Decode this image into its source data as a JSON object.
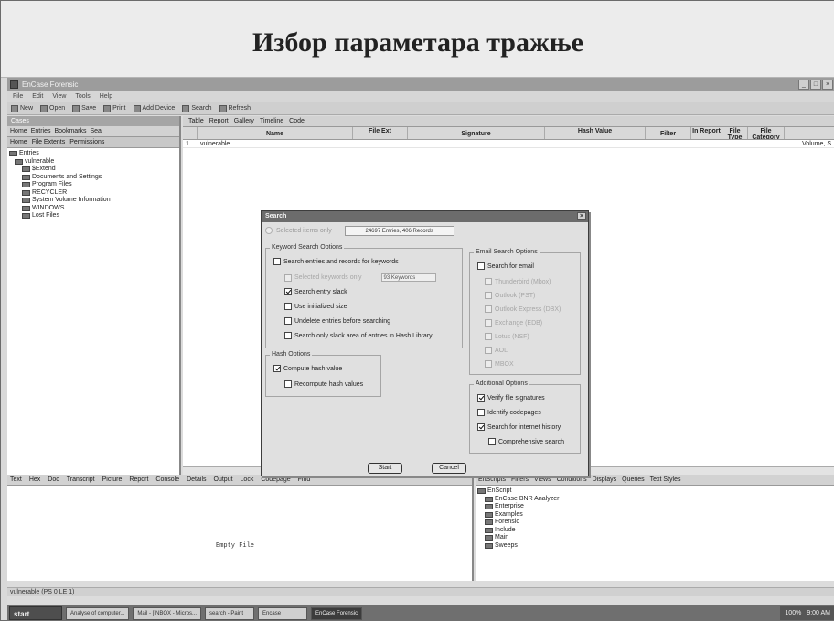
{
  "slide": {
    "title": "Избор параметара тражње"
  },
  "app": {
    "title": "EnCase Forensic",
    "menu": [
      "File",
      "Edit",
      "View",
      "Tools",
      "Help"
    ],
    "toolbar": [
      "New",
      "Open",
      "Save",
      "Print",
      "Add Device",
      "Search",
      "Refresh"
    ]
  },
  "left_pane": {
    "header": "Cases",
    "tabs": [
      "Home",
      "Entries",
      "Bookmarks",
      "Sea"
    ],
    "tabs2": [
      "Home",
      "File Extents",
      "Permissions"
    ],
    "tree": [
      "Entries",
      "vulnerable",
      "$Extend",
      "Documents and Settings",
      "Program Files",
      "RECYCLER",
      "System Volume Information",
      "WINDOWS",
      "Lost Files"
    ]
  },
  "right_pane": {
    "tabs": [
      "Table",
      "Report",
      "Gallery",
      "Timeline",
      "Code"
    ],
    "columns": [
      "Name",
      "File Ext",
      "Signature",
      "Hash Value",
      "Filter",
      "In Report",
      "File Type",
      "File Category"
    ],
    "rows": [
      {
        "name": "vulnerable"
      }
    ],
    "extra_col": "Volume, S"
  },
  "bottom_left": {
    "tabs": [
      "Text",
      "Hex",
      "Doc",
      "Transcript",
      "Picture",
      "Report",
      "Console",
      "Details",
      "Output",
      "Lock",
      "Codepage",
      "Find"
    ],
    "empty_text": "Empty File"
  },
  "bottom_right": {
    "tabs": [
      "EnScripts",
      "Filters",
      "Views",
      "Conditions",
      "Displays",
      "Queries",
      "Text Styles"
    ],
    "tree": [
      "EnScript",
      "EnCase BNR Analyzer",
      "Enterprise",
      "Examples",
      "Forensic",
      "Include",
      "Main",
      "Sweeps"
    ]
  },
  "status": "vulnerable (PS 0 LE 1)",
  "taskbar": {
    "start": "start",
    "buttons": [
      "Analyse of computer...",
      "Mail - [INBOX - Micros...",
      "search - Paint",
      "Encase",
      "EnCase Forensic"
    ],
    "zoom": "100%",
    "time": "9:00 AM"
  },
  "dialog": {
    "title": "Search",
    "selected_label": "Selected items only",
    "entries_count": "24697 Entries, 406 Records",
    "keyword_group": "Keyword Search Options",
    "keyword_options": [
      {
        "label": "Search entries and records for keywords",
        "checked": false,
        "disabled": false
      },
      {
        "label": "Selected keywords only",
        "checked": false,
        "disabled": true,
        "field": "93 Keywords"
      },
      {
        "label": "Search entry slack",
        "checked": true,
        "disabled": false
      },
      {
        "label": "Use initialized size",
        "checked": false,
        "disabled": false
      },
      {
        "label": "Undelete entries before searching",
        "checked": false,
        "disabled": false
      },
      {
        "label": "Search only slack area of entries in Hash Library",
        "checked": false,
        "disabled": false
      }
    ],
    "hash_group": "Hash Options",
    "hash_options": [
      {
        "label": "Compute hash value",
        "checked": true
      },
      {
        "label": "Recompute hash values",
        "checked": false
      }
    ],
    "email_group": "Email Search Options",
    "email_search_label": "Search for email",
    "email_options": [
      "Thunderbird (Mbox)",
      "Outlook (PST)",
      "Outlook Express (DBX)",
      "Exchange (EDB)",
      "Lotus (NSF)",
      "AOL",
      "MBOX"
    ],
    "additional_group": "Additional Options",
    "additional_options": [
      {
        "label": "Verify file signatures",
        "checked": true
      },
      {
        "label": "Identify codepages",
        "checked": false
      },
      {
        "label": "Search for internet history",
        "checked": true
      },
      {
        "label": "Comprehensive search",
        "checked": false
      }
    ],
    "start_button": "Start",
    "cancel_button": "Cancel"
  }
}
